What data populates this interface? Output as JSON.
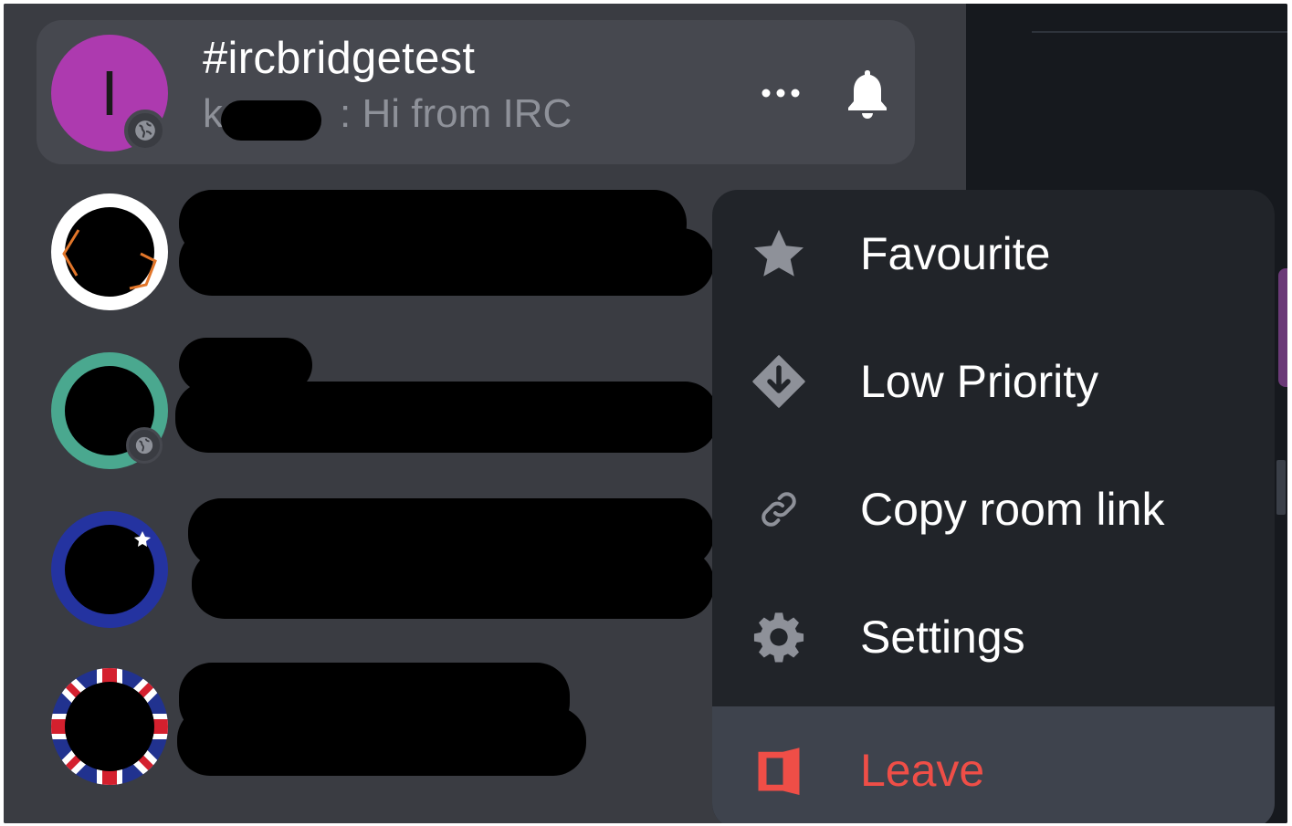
{
  "active_room": {
    "avatar_letter": "I",
    "name": "#ircbridgetest",
    "preview_message": ": Hi from IRC",
    "sender_visible_initial": "k",
    "avatar_color": "#ad3aaf"
  },
  "header_actions": {
    "more_icon": "ellipsis-icon",
    "notification_icon": "bell-icon"
  },
  "context_menu": {
    "items": [
      {
        "label": "Favourite",
        "icon": "star-icon"
      },
      {
        "label": "Low Priority",
        "icon": "arrow-down-diamond-icon"
      },
      {
        "label": "Copy room link",
        "icon": "link-icon"
      },
      {
        "label": "Settings",
        "icon": "gear-icon"
      },
      {
        "label": "Leave",
        "icon": "leave-door-icon"
      }
    ],
    "leave_color": "#ef4e47"
  },
  "colors": {
    "room_list_bg": "#3a3c42",
    "menu_bg": "#212429",
    "accent_purple": "#ad3aaf",
    "ring_teal": "#4aa88f",
    "ring_blue": "#2433a0"
  }
}
